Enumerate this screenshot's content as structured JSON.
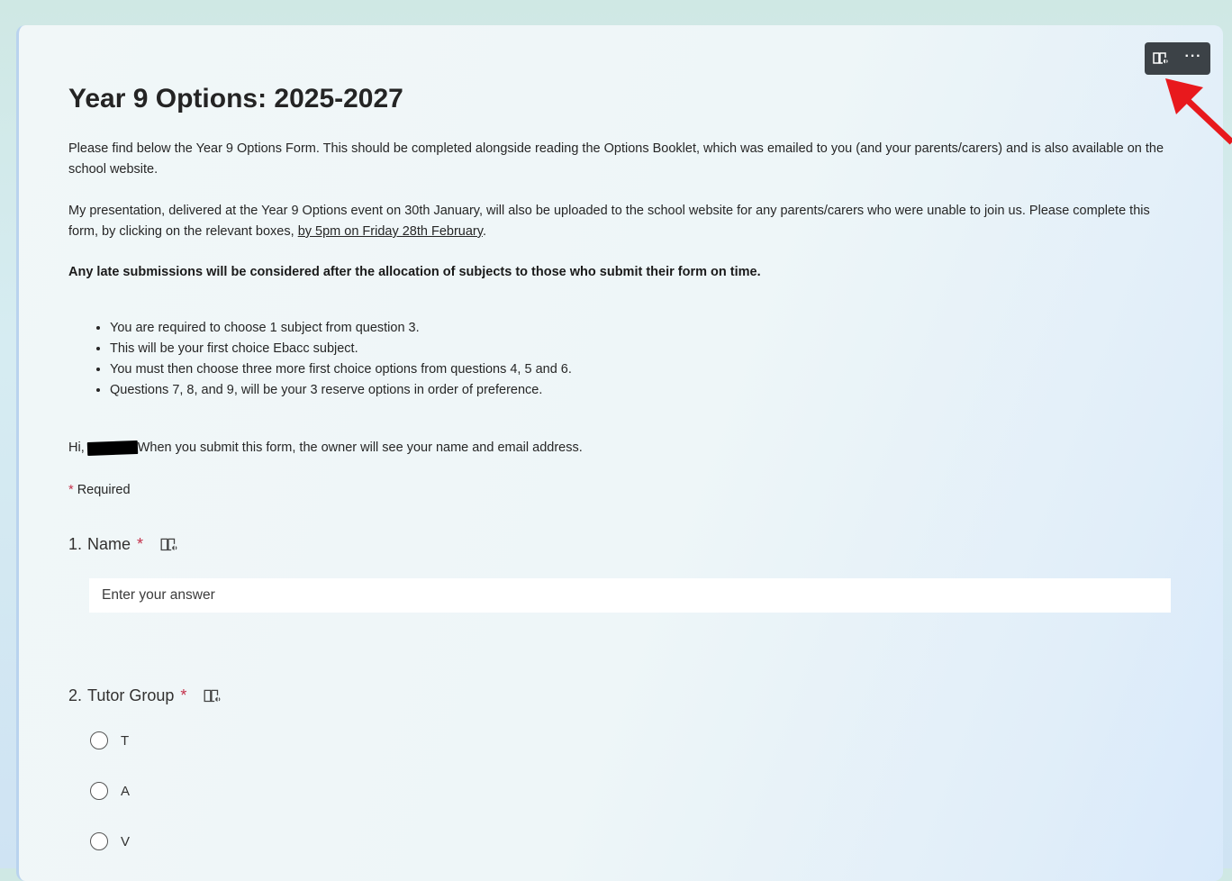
{
  "toolbar": {
    "immersive_reader_icon": "immersive-reader-icon",
    "more_icon": "more-options-icon",
    "more_label": "···"
  },
  "form": {
    "title": "Year 9 Options: 2025-2027",
    "intro_1": "Please find below the Year 9 Options Form. This should be completed alongside reading the Options Booklet, which was emailed to you (and your parents/carers) and is also available on the school website.",
    "intro_2": "My presentation, delivered at the Year 9 Options event on 30th January, will also be uploaded to the school website for any parents/carers who were unable to join us. Please complete this form, by clicking on the relevant boxes, ",
    "deadline": "by 5pm on Friday 28th February",
    "deadline_suffix": ".",
    "late_notice": "Any late submissions will be considered after the allocation of subjects to those who submit their form on time.",
    "rules": [
      "You are required to choose 1 subject from question 3.",
      "This will be your first choice Ebacc subject.",
      "You must then choose three more first choice options from questions 4, 5 and 6.",
      "Questions 7, 8, and 9, will be your 3 reserve options in order of preference."
    ],
    "greeting_prefix": "Hi,",
    "greeting_suffix": "When you submit this form, the owner will see your name and email address.",
    "required_note": "Required",
    "required_star": "*"
  },
  "questions": {
    "q1": {
      "number": "1.",
      "label": "Name",
      "star": "*",
      "placeholder": "Enter your answer",
      "value": ""
    },
    "q2": {
      "number": "2.",
      "label": "Tutor Group",
      "star": "*",
      "options": [
        "T",
        "A",
        "V"
      ]
    }
  },
  "colors": {
    "accent_required": "#c4314b",
    "annotation_arrow": "#e8191d",
    "toolbar_bg": "#3c4247"
  }
}
